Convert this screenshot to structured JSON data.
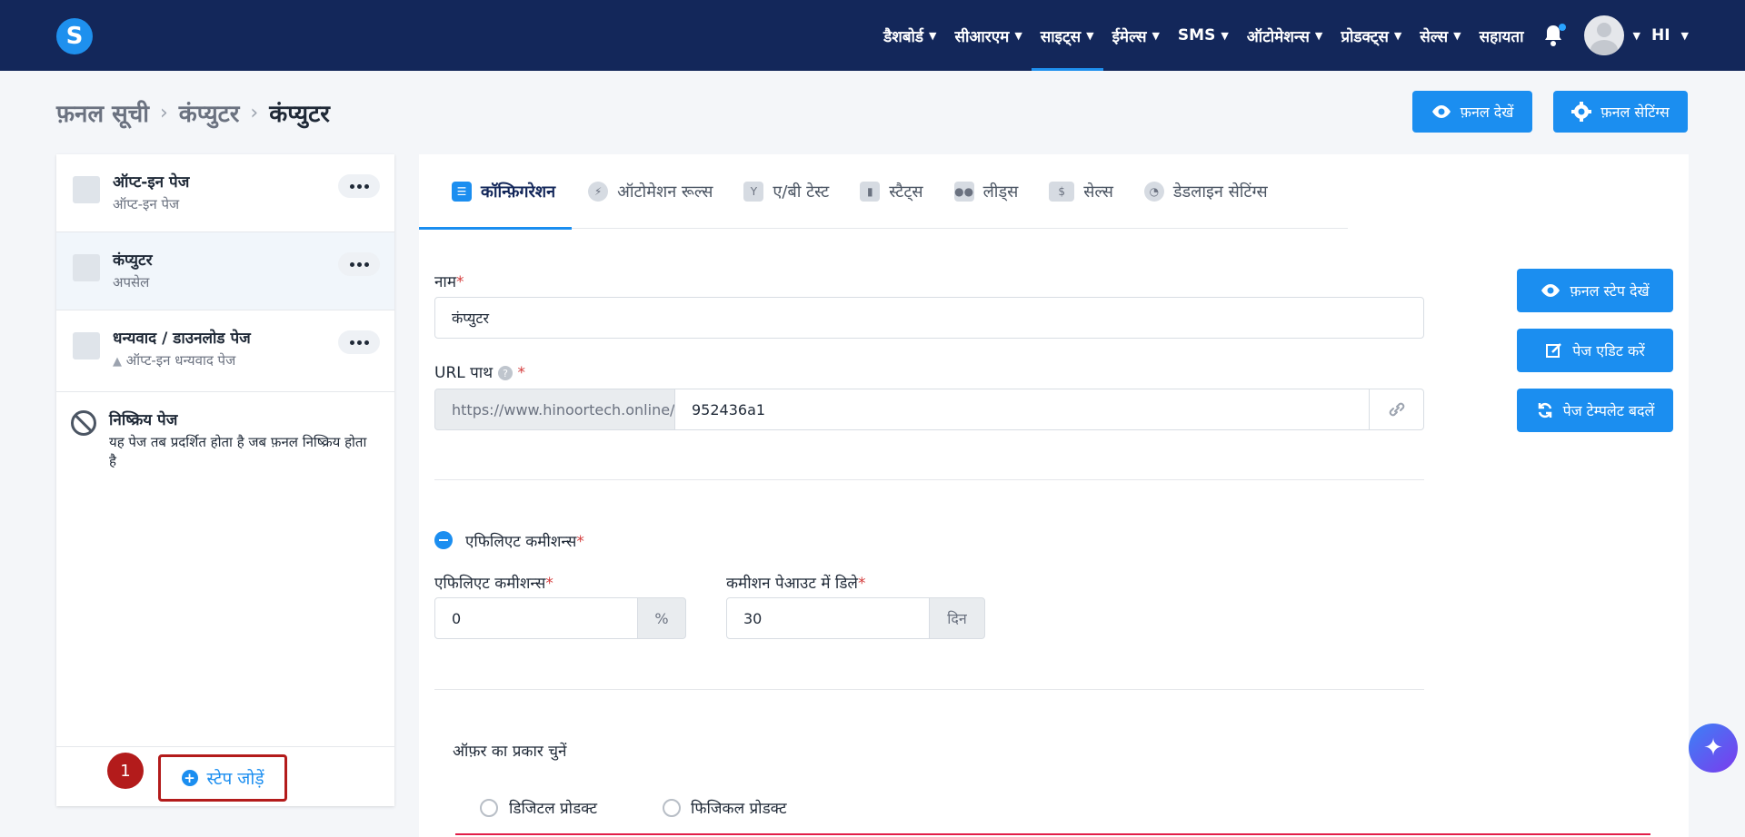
{
  "nav": {
    "logo": "S",
    "items": [
      {
        "label": "डैशबोर्ड",
        "dropdown": true
      },
      {
        "label": "सीआरएम",
        "dropdown": true
      },
      {
        "label": "साइट्स",
        "dropdown": true,
        "active": true
      },
      {
        "label": "ईमेल्स",
        "dropdown": true
      },
      {
        "label": "SMS",
        "dropdown": true
      },
      {
        "label": "ऑटोमेशन्स",
        "dropdown": true
      },
      {
        "label": "प्रोडक्ट्स",
        "dropdown": true
      },
      {
        "label": "सेल्स",
        "dropdown": true
      },
      {
        "label": "सहायता",
        "dropdown": false
      }
    ],
    "user_initials": "HI"
  },
  "breadcrumb": {
    "root": "फ़नल सूची",
    "parent": "कंप्युटर",
    "current": "कंप्युटर"
  },
  "header_buttons": {
    "view_funnel": "फ़नल देखें",
    "funnel_settings": "फ़नल सेटिंग्स"
  },
  "steps": [
    {
      "title": "ऑप्ट-इन पेज",
      "subtitle": "ऑप्ट-इन पेज",
      "selected": false
    },
    {
      "title": "कंप्युटर",
      "subtitle": "अपसेल",
      "selected": true
    },
    {
      "title": "धन्यवाद / डाउनलोड पेज",
      "subtitle": "ऑप्ट-इन धन्यवाद पेज",
      "selected": false,
      "warning": true
    }
  ],
  "inactive": {
    "title": "निष्क्रिय पेज",
    "desc": "यह पेज तब प्रदर्शित होता है जब फ़नल निष्क्रिय होता है"
  },
  "add_step": {
    "number": "1",
    "label": "स्टेप जोड़ें"
  },
  "tabs": [
    {
      "label": "कॉन्फ़िगरेशन",
      "icon": "sliders-icon",
      "active": true
    },
    {
      "label": "ऑटोमेशन रूल्स",
      "icon": "bolt-icon"
    },
    {
      "label": "ए/बी टेस्ट",
      "icon": "split-icon"
    },
    {
      "label": "स्टैट्स",
      "icon": "bar-chart-icon"
    },
    {
      "label": "लीड्स",
      "icon": "users-icon"
    },
    {
      "label": "सेल्स",
      "icon": "dollar-icon"
    },
    {
      "label": "डेडलाइन सेटिंग्स",
      "icon": "clock-icon"
    }
  ],
  "form": {
    "name_label": "नाम",
    "name_value": "कंप्युटर",
    "url_label": "URL पाथ",
    "url_prefix": "https://www.hinoortech.online/",
    "url_value": "952436a1",
    "affiliate_toggle_label": "एफिलिएट कमीशन्स",
    "affiliate_label": "एफिलिएट कमीशन्स",
    "affiliate_value": "0",
    "affiliate_unit": "%",
    "payout_label": "कमीशन पेआउट में डिले",
    "payout_value": "30",
    "payout_unit": "दिन",
    "offer_type_label": "ऑफ़र का प्रकार चुनें",
    "offer_digital": "डिजिटल प्रोडक्ट",
    "offer_physical": "फिजिकल प्रोडक्ट"
  },
  "side_buttons": {
    "view_step": "फ़नल स्टेप देखें",
    "edit_page": "पेज एडिट करें",
    "change_template": "पेज टेम्पलेट बदलें"
  },
  "colors": {
    "nav_bg": "#13275a",
    "primary": "#1b8ef0",
    "highlight_red": "#b31b1b"
  }
}
